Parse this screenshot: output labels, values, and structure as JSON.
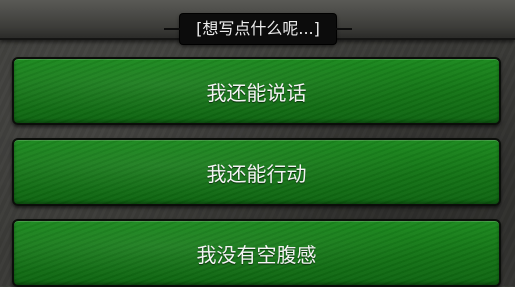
{
  "dialog": {
    "title": "[想写点什么呢...]"
  },
  "choices": [
    {
      "label": "我还能说话"
    },
    {
      "label": "我还能行动"
    },
    {
      "label": "我没有空腹感"
    }
  ],
  "colors": {
    "button_green": "#157a18",
    "title_background": "#0c0c0c",
    "page_background": "#3b3b38"
  }
}
